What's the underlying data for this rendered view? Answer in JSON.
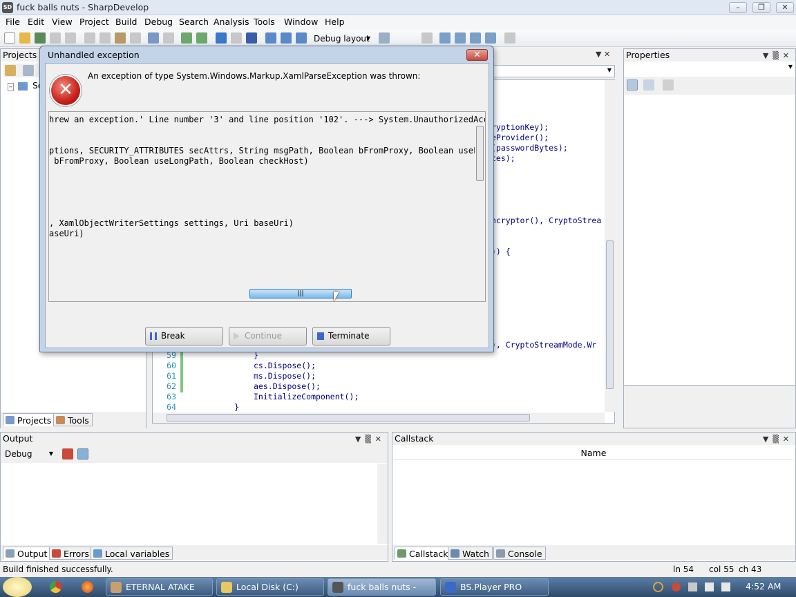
{
  "window": {
    "title": "fuck balls nuts - SharpDevelop",
    "icon": "sd-icon",
    "min": "–",
    "max": "❐",
    "close": "✕"
  },
  "menu": [
    "File",
    "Edit",
    "View",
    "Project",
    "Build",
    "Debug",
    "Search",
    "Analysis",
    "Tools",
    "Window",
    "Help"
  ],
  "toolbar": {
    "layout": "Debug layout"
  },
  "projects": {
    "title": "Projects",
    "tree_item": "Sc",
    "tabs": [
      "Projects",
      "Tools"
    ]
  },
  "properties": {
    "title": "Properties"
  },
  "editor": {
    "code_right": [
      {
        "text": "ryptionKey);"
      },
      {
        "text": "eProvider();"
      },
      {
        "text": "(passwordBytes);"
      },
      {
        "text": "tes);"
      },
      {
        "text": "ncryptor(), CryptoStrea"
      },
      {
        "text": ")) {"
      },
      {
        "text": "), CryptoStreamMode.Wr"
      }
    ],
    "lines": [
      {
        "num": "59",
        "code": "}"
      },
      {
        "num": "60",
        "code": "cs.Dispose();"
      },
      {
        "num": "61",
        "code": "ms.Dispose();"
      },
      {
        "num": "62",
        "code": "aes.Dispose();"
      },
      {
        "num": "63",
        "code": "InitializeComponent();"
      },
      {
        "num": "64",
        "code": "}"
      }
    ]
  },
  "output": {
    "title": "Output",
    "source": "Debug",
    "tabs": [
      "Output",
      "Errors",
      "Local variables"
    ]
  },
  "callstack": {
    "title": "Callstack",
    "column": "Name",
    "tabs": [
      "Callstack",
      "Watch",
      "Console"
    ]
  },
  "status": {
    "message": "Build finished successfully.",
    "ln": "ln 54",
    "col": "col 55",
    "ch": "ch 43"
  },
  "dialog": {
    "title": "Unhandled exception",
    "close": "✕",
    "message": "An exception of type System.Windows.Markup.XamlParseException was thrown:",
    "trace": [
      "hrew an exception.' Line number '3' and line position '102'. ---> System.UnauthorizedAcc",
      "",
      "",
      "ptions, SECURITY_ATTRIBUTES secAttrs, String msgPath, Boolean bFromProxy, Boolean useLo",
      " bFromProxy, Boolean useLongPath, Boolean checkHost)",
      "",
      "",
      "",
      "",
      "",
      ", XamlObjectWriterSettings settings, Uri baseUri)",
      "aseUri)"
    ],
    "buttons": {
      "break": "Break",
      "continue": "Continue",
      "terminate": "Terminate"
    }
  },
  "taskbar": {
    "items": [
      "ETERNAL ATAKE",
      "Local Disk (C:)",
      "fuck balls nuts - Shar...",
      "BS.Player PRO"
    ],
    "clock": "4:52 AM"
  }
}
